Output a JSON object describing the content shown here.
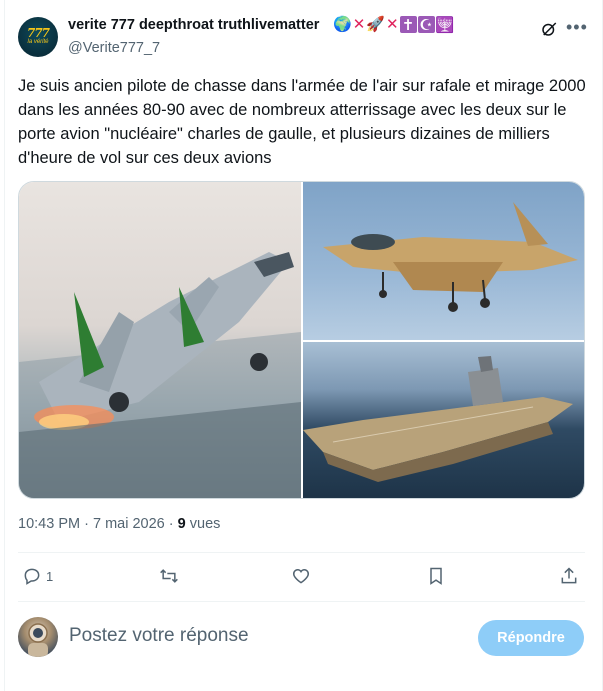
{
  "post": {
    "author_name": "verite 777 deepthroat truthlivematter",
    "author_badges": [
      "🌍",
      "✕",
      "🚀",
      "✕",
      "✝",
      "☪",
      "🕎"
    ],
    "handle": "@Verite777_7",
    "avatar_text": "777",
    "avatar_subtext": "la vérité",
    "text": "Je suis ancien pilote de chasse dans l'armée de l'air sur rafale et mirage 2000 dans les années 80-90 avec de nombreux atterrissage avec les deux sur le porte avion \"nucléaire\" charles de gaulle, et plusieurs dizaines de milliers d'heure de vol sur ces deux avions",
    "media": [
      {
        "icon": "fighter-jet-takeoff-photo"
      },
      {
        "icon": "fighter-jet-desert-camo-photo"
      },
      {
        "icon": "aircraft-carrier-photo"
      }
    ],
    "time": "10:43 PM",
    "separator": "·",
    "date": "7 mai 2026",
    "views_count": "9",
    "views_label": "vues"
  },
  "actions": {
    "reply_count": "1",
    "repost_count": "",
    "like_count": "",
    "bookmark_count": ""
  },
  "reply_box": {
    "placeholder": "Postez votre réponse",
    "button_label": "Répondre"
  },
  "colors": {
    "accent_disabled": "#8ecdf8",
    "text_primary": "#0f1419",
    "text_secondary": "#536471",
    "border": "#cfd9de"
  }
}
